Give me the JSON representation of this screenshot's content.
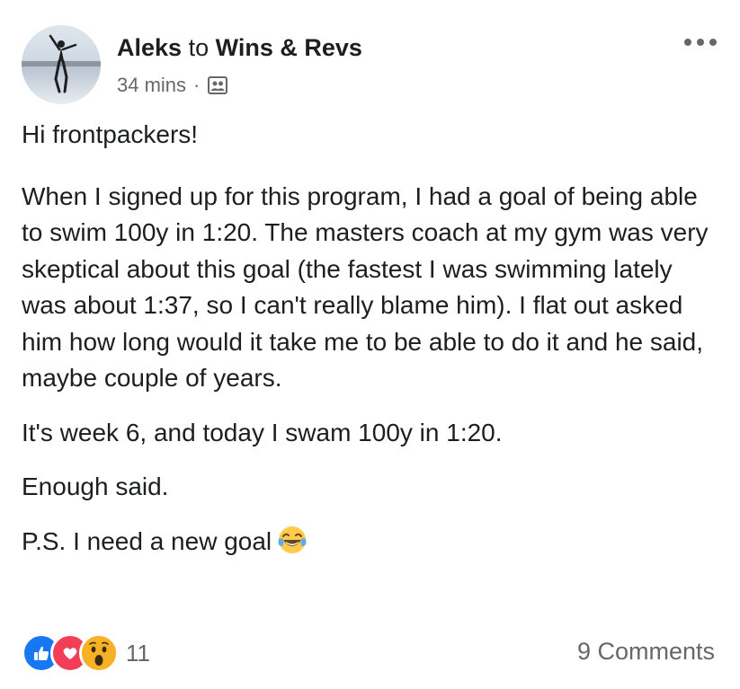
{
  "post": {
    "author": "Aleks",
    "to_word": "to",
    "group": "Wins & Revs",
    "time": "34 mins",
    "separator": "·",
    "audience_icon": "group-audience-icon",
    "more_icon": "more-options-icon",
    "paragraphs": [
      "Hi frontpackers!",
      "When I signed up for this program, I had a goal of being able to swim 100y in 1:20. The masters coach at my gym was very skeptical about this goal (the fastest I was swimming lately was about 1:37, so I can't really blame him). I flat out asked him how long would it take me to be able to do it and he said, maybe couple of years.",
      "It's week 6, and today I swam 100y in 1:20.",
      "Enough said.",
      "P.S. I need a new goal"
    ],
    "final_emoji": "laughing-tears-emoji"
  },
  "footer": {
    "reactions": [
      "like-reaction-icon",
      "love-reaction-icon",
      "wow-reaction-icon"
    ],
    "reaction_count": "11",
    "comments": "9 Comments"
  },
  "colors": {
    "text": "#1c1e21",
    "secondary": "#65676b",
    "like_blue": "#1877f2",
    "love_red": "#f33e58",
    "wow_yellow": "#f7b125"
  }
}
